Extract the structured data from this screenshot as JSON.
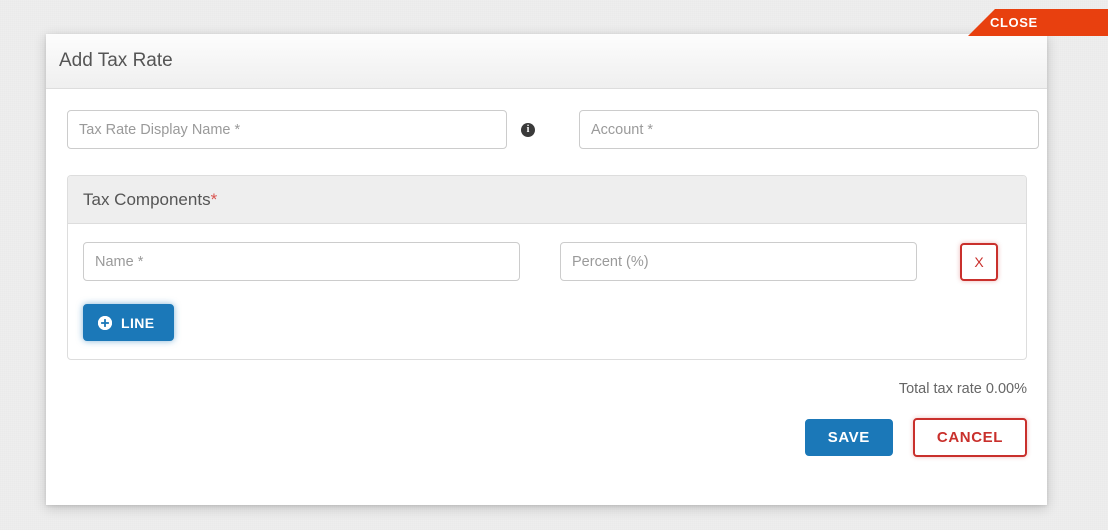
{
  "close_tab": {
    "label": "CLOSE",
    "color": "#e8400f"
  },
  "dialog": {
    "title": "Add Tax Rate",
    "fields": {
      "tax_rate_display_name": {
        "placeholder": "Tax Rate Display Name *",
        "value": ""
      },
      "account": {
        "placeholder": "Account *",
        "value": ""
      },
      "info_icon": "info-icon"
    },
    "tax_components": {
      "title": "Tax Components",
      "required_marker": "*",
      "rows": [
        {
          "name_placeholder": "Name *",
          "name_value": "",
          "percent_placeholder": "Percent (%)",
          "percent_value": "",
          "delete_label": "X"
        }
      ],
      "add_line_label": "LINE",
      "add_line_icon": "plus-circle-icon"
    },
    "total_tax_rate_label": "Total tax rate 0.00%",
    "actions": {
      "save_label": "SAVE",
      "cancel_label": "CANCEL"
    }
  },
  "colors": {
    "primary_blue": "#1b78b8",
    "danger_red": "#c9302c",
    "close_orange": "#e8400f"
  }
}
